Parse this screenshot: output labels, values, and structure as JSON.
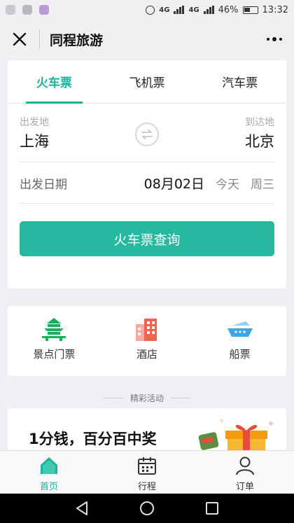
{
  "status_bar": {
    "network_label": "4G",
    "network_label_2": "4G",
    "battery_percent": "46%",
    "time": "13:32"
  },
  "nav": {
    "title": "同程旅游"
  },
  "tabs": [
    {
      "label": "火车票",
      "active": true
    },
    {
      "label": "飞机票",
      "active": false
    },
    {
      "label": "汽车票",
      "active": false
    }
  ],
  "route": {
    "from_label": "出发地",
    "from_city": "上海",
    "to_label": "到达地",
    "to_city": "北京"
  },
  "date": {
    "label": "出发日期",
    "value": "08月02日",
    "today": "今天",
    "weekday": "周三"
  },
  "query_button": "火车票查询",
  "quick_links": [
    {
      "label": "景点门票",
      "icon": "attraction-ticket-icon",
      "color": "#1cae5a"
    },
    {
      "label": "酒店",
      "icon": "hotel-icon",
      "color": "#f0644f"
    },
    {
      "label": "船票",
      "icon": "ship-icon",
      "color": "#3aa6e6"
    }
  ],
  "section_title": "精彩活动",
  "promo": {
    "text": "1分钱，百分百中奖"
  },
  "tab_bar": [
    {
      "label": "首页",
      "icon": "home-icon",
      "active": true
    },
    {
      "label": "行程",
      "icon": "calendar-icon",
      "active": false
    },
    {
      "label": "订单",
      "icon": "user-icon",
      "active": false
    }
  ],
  "colors": {
    "accent": "#1fb19a",
    "button": "#27b8a0",
    "background": "#efeff4"
  }
}
